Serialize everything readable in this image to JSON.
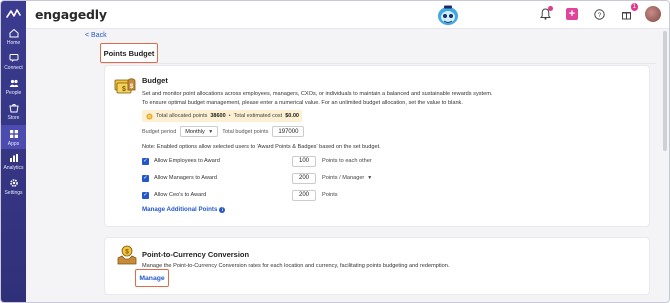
{
  "app": {
    "logo_text": "engagedly"
  },
  "topbar": {
    "notification_badge": "1"
  },
  "sidebar": {
    "items": [
      {
        "label": "Home"
      },
      {
        "label": "Connect"
      },
      {
        "label": "People"
      },
      {
        "label": "Store"
      },
      {
        "label": "Apps"
      },
      {
        "label": "Analytics"
      },
      {
        "label": "Settings"
      }
    ]
  },
  "nav": {
    "back_label": "Back"
  },
  "page": {
    "title": "Points Budget"
  },
  "budget": {
    "title": "Budget",
    "description_line1": "Set and monitor point allocations across employees, managers, CXOs, or individuals to maintain a balanced and sustainable rewards system.",
    "description_line2": "To ensure optimal budget management, please enter a numerical value. For an unlimited budget allocation, set the value to blank.",
    "allocated_label": "Total allocated points",
    "allocated_value": "38600",
    "separator": "•",
    "estimated_label": "Total estimated cost",
    "estimated_value": "$0.00",
    "period_label": "Budget period",
    "period_value": "Monthly",
    "total_budget_label": "Total budget points",
    "total_budget_value": "197000",
    "note": "Note: Enabled options allow selected users to 'Award Points & Badges' based on the set budget.",
    "awards": [
      {
        "label": "Allow Employees to Award",
        "value": "100",
        "unit": "Points to each other",
        "has_dropdown": false
      },
      {
        "label": "Allow Managers to Award",
        "value": "200",
        "unit": "Points / Manager",
        "has_dropdown": true
      },
      {
        "label": "Allow Ceo's to Award",
        "value": "200",
        "unit": "Points",
        "has_dropdown": false
      }
    ],
    "manage_additional": "Manage Additional Points"
  },
  "conversion": {
    "title": "Point-to-Currency Conversion",
    "description": "Manage the Point-to-Currency Conversion rates for each location and currency, facilitating points budgeting and redemption.",
    "manage_label": "Manage"
  },
  "colors": {
    "sidebar": "#3b3b90",
    "link": "#2458c8",
    "highlight": "#e06a4a",
    "accent_pink": "#e0449a",
    "alloc_bg": "#fcefd2"
  }
}
